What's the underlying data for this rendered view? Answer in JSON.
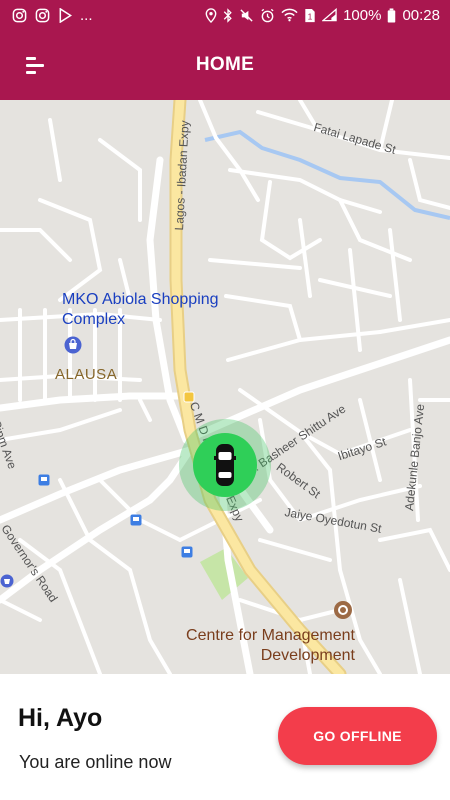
{
  "status_bar": {
    "left_icons": [
      "instagram-icon",
      "instagram-icon",
      "play-store-icon",
      "more-dots-icon"
    ],
    "more": "...",
    "battery": "100%",
    "time": "00:28"
  },
  "app_bar": {
    "title": "HOME",
    "menu_icon": "menu-icon",
    "color": "#a9174f"
  },
  "map": {
    "labels": {
      "fatai": "Fatai Lapade St",
      "lagos_ibadan": "Lagos - Ibadan Expy",
      "mko": "MKO Abiola Shopping Complex",
      "alausa": "ALAUSA",
      "cmd": "C M D Rd",
      "basheer": "Alh. Basheer Shittu Ave",
      "ibitayo": "Ibitayo St",
      "adekunle": "Adekunle Banjo Ave",
      "robert": "Robert St",
      "jaiye": "Jaiye Oyedotun St",
      "lagos_ojo": "Lagos-Ojo Expy",
      "obafemi": "Cipm Ave",
      "governors": "Governor's Road",
      "centre": "Centre for Management Development"
    },
    "driver_marker_color": "#2fcf58"
  },
  "bottom": {
    "greeting": "Hi, Ayo",
    "status": "You are online now",
    "button_label": "GO OFFLINE",
    "button_color": "#f33d4b"
  }
}
